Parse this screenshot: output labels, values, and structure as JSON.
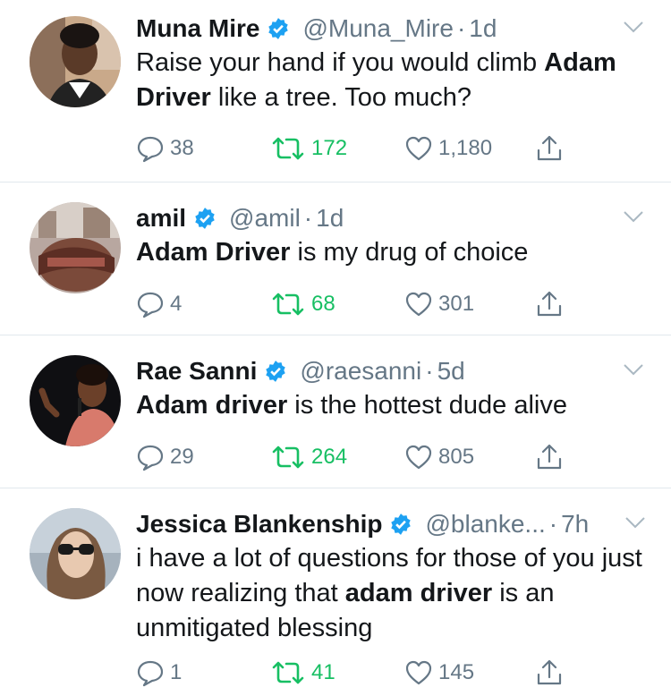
{
  "tweets": [
    {
      "name": "Muna Mire",
      "handle": "@Muna_Mire",
      "time": "1d",
      "text_before": "Raise your hand if you would climb ",
      "text_bold": "Adam Driver",
      "text_after": " like a tree. Too much?",
      "replies": "38",
      "retweets": "172",
      "likes": "1,180"
    },
    {
      "name": "amil",
      "handle": "@amil",
      "time": "1d",
      "text_before": "",
      "text_bold": "Adam Driver",
      "text_after": " is my drug of choice",
      "replies": "4",
      "retweets": "68",
      "likes": "301"
    },
    {
      "name": "Rae Sanni",
      "handle": "@raesanni",
      "time": "5d",
      "text_before": "",
      "text_bold": "Adam driver",
      "text_after": " is the hottest dude alive",
      "replies": "29",
      "retweets": "264",
      "likes": "805"
    },
    {
      "name": "Jessica Blankenship",
      "handle": "@blanke...",
      "time": "7h",
      "text_before": "i have a lot of questions for those of you just now realizing that ",
      "text_bold": "adam driver",
      "text_after": " is an unmitigated blessing",
      "replies": "1",
      "retweets": "41",
      "likes": "145"
    }
  ],
  "colors": {
    "verified": "#1da1f2",
    "retweet": "#17bf63",
    "meta": "#657786",
    "divider": "#e1e8ed"
  },
  "icons": [
    "verified-badge-icon",
    "chevron-down-icon",
    "reply-icon",
    "retweet-icon",
    "like-icon",
    "share-icon"
  ]
}
